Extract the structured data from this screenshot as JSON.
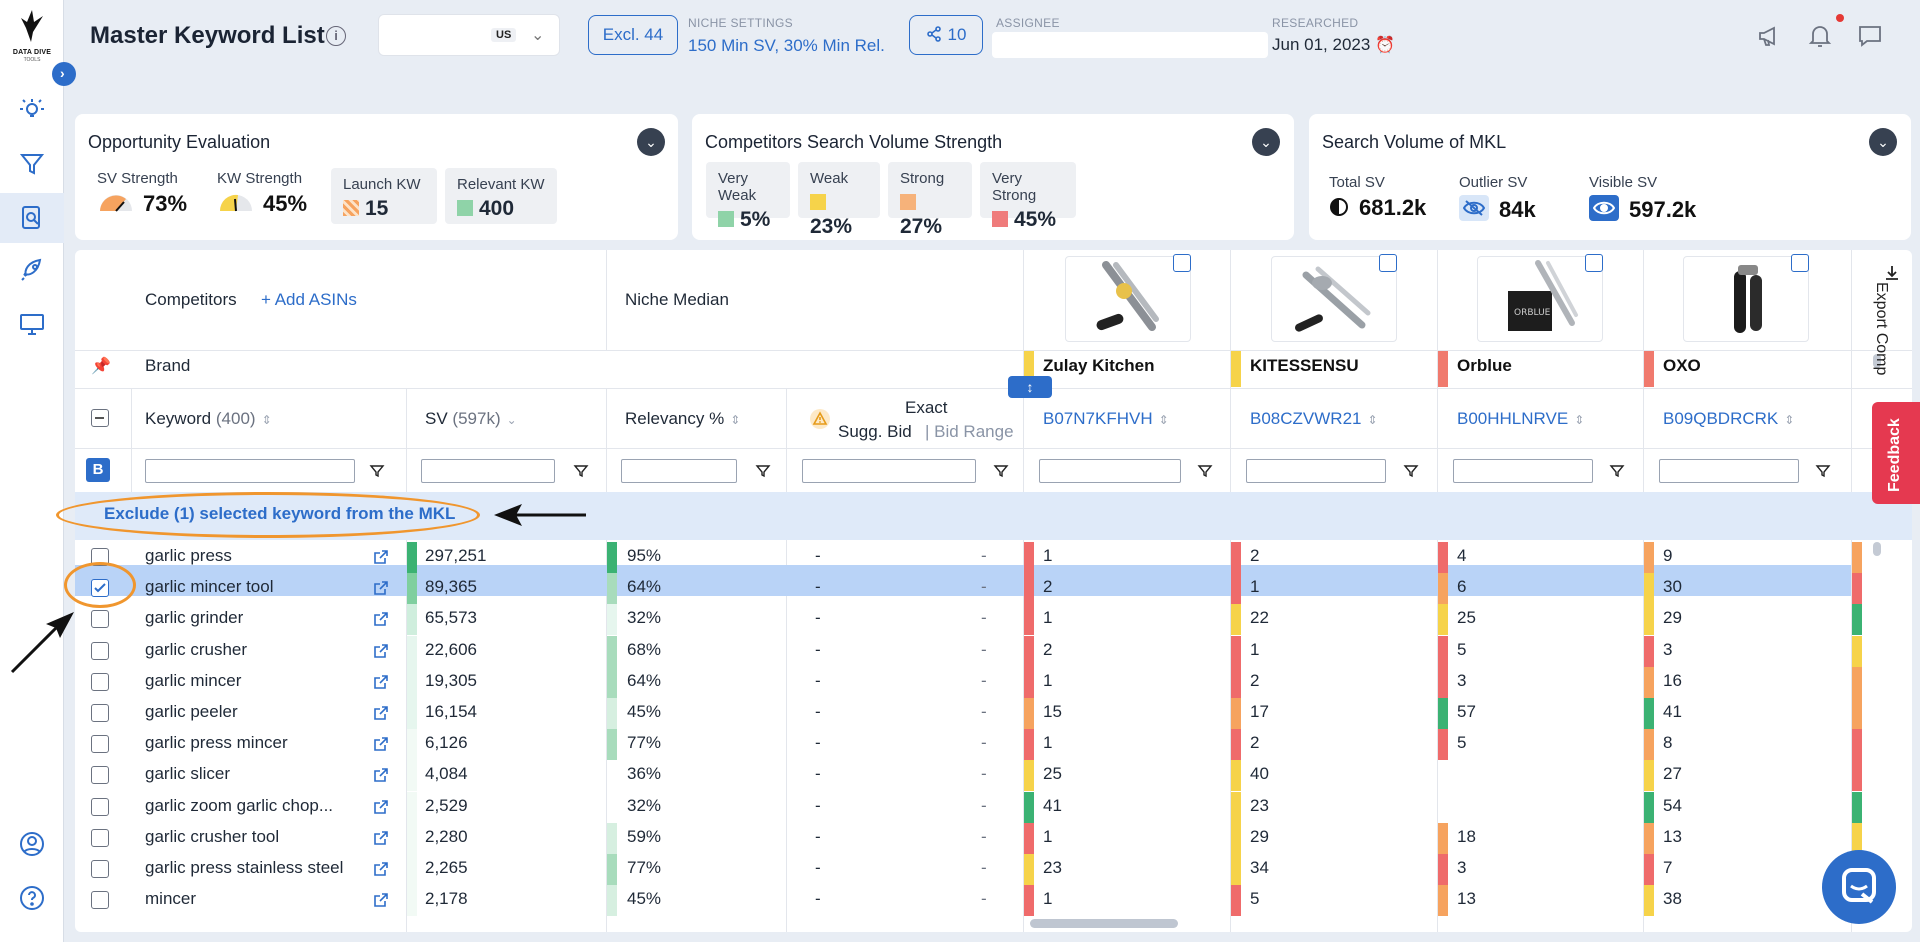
{
  "app": {
    "brand": "DATA DIVE",
    "brand_sub": "TOOLS"
  },
  "header": {
    "title": "Master Keyword List",
    "marketplace": "US",
    "excl_label": "Excl. 44",
    "niche_settings_label": "NICHE SETTINGS",
    "niche_settings_value": "150 Min SV, 30% Min Rel.",
    "share_count": "10",
    "assignee_label": "ASSIGNEE",
    "researched_label": "RESEARCHED",
    "researched_date": "Jun 01, 2023"
  },
  "opportunity": {
    "title": "Opportunity Evaluation",
    "sv_strength_label": "SV Strength",
    "sv_strength": "73%",
    "kw_strength_label": "KW Strength",
    "kw_strength": "45%",
    "launch_kw_label": "Launch KW",
    "launch_kw": "15",
    "relevant_kw_label": "Relevant KW",
    "relevant_kw": "400"
  },
  "competitors_strength": {
    "title": "Competitors Search Volume Strength",
    "very_weak_label": "Very Weak",
    "very_weak": "5%",
    "weak_label": "Weak",
    "weak": "23%",
    "strong_label": "Strong",
    "strong": "27%",
    "very_strong_label": "Very Strong",
    "very_strong": "45%"
  },
  "search_volume": {
    "title": "Search Volume of MKL",
    "total_label": "Total SV",
    "total": "681.2k",
    "outlier_label": "Outlier SV",
    "outlier": "84k",
    "visible_label": "Visible SV",
    "visible": "597.2k"
  },
  "table": {
    "competitors_label": "Competitors",
    "add_asins": "+ Add ASINs",
    "niche_median": "Niche Median",
    "brand_label": "Brand",
    "keyword_col": "Keyword",
    "keyword_count": "(400)",
    "sv_col": "SV",
    "sv_total": "(597k)",
    "relevancy_col": "Relevancy %",
    "exact_label": "Exact",
    "sugg_bid": "Sugg. Bid",
    "bid_range": "Bid Range",
    "filter_badge": "B",
    "exclude_banner": "Exclude (1) selected keyword from the MKL",
    "export_label": "Export Comp",
    "feedback_label": "Feedback",
    "competitors": [
      {
        "brand": "Zulay Kitchen",
        "asin": "B07N7KFHVH",
        "color": "#f6d34a"
      },
      {
        "brand": "KITESSENSU",
        "asin": "B08CZVWR21",
        "color": "#f6d34a"
      },
      {
        "brand": "Orblue",
        "asin": "B00HHLNRVE",
        "color": "#f07a6e"
      },
      {
        "brand": "OXO",
        "asin": "B09QBDRCRK",
        "color": "#f07a6e"
      }
    ],
    "rows": [
      {
        "keyword": "garlic press",
        "sv": "297,251",
        "rel": "95%",
        "bid": "-",
        "range": "-",
        "c": [
          "1",
          "2",
          "4",
          "9"
        ],
        "cc": [
          "#ef6b6b",
          "#ef6b6b",
          "#ef6b6b",
          "#f6a35f"
        ],
        "svbar": "#3bb273",
        "relbar": "#3bb273",
        "next": "#f6a35f",
        "checked": false
      },
      {
        "keyword": "garlic mincer tool",
        "sv": "89,365",
        "rel": "64%",
        "bid": "-",
        "range": "-",
        "c": [
          "2",
          "1",
          "6",
          "30"
        ],
        "cc": [
          "#ef6b6b",
          "#ef6b6b",
          "#f6a35f",
          "#f6d34a"
        ],
        "svbar": "#7fcf9f",
        "relbar": "#a8dcbc",
        "next": "#ef6b6b",
        "checked": true
      },
      {
        "keyword": "garlic grinder",
        "sv": "65,573",
        "rel": "32%",
        "bid": "-",
        "range": "-",
        "c": [
          "1",
          "22",
          "25",
          "29"
        ],
        "cc": [
          "#ef6b6b",
          "#f6d34a",
          "#f6d34a",
          "#f6d34a"
        ],
        "svbar": "#cfeedd",
        "relbar": "#e6f6ee",
        "next": "#3bb273",
        "checked": false
      },
      {
        "keyword": "garlic crusher",
        "sv": "22,606",
        "rel": "68%",
        "bid": "-",
        "range": "-",
        "c": [
          "2",
          "1",
          "5",
          "3"
        ],
        "cc": [
          "#ef6b6b",
          "#ef6b6b",
          "#ef6b6b",
          "#ef6b6b"
        ],
        "svbar": "#e6f6ee",
        "relbar": "#a8dcbc",
        "next": "#f6d34a",
        "checked": false
      },
      {
        "keyword": "garlic mincer",
        "sv": "19,305",
        "rel": "64%",
        "bid": "-",
        "range": "-",
        "c": [
          "1",
          "2",
          "3",
          "16"
        ],
        "cc": [
          "#ef6b6b",
          "#ef6b6b",
          "#ef6b6b",
          "#f6a35f"
        ],
        "svbar": "#e6f6ee",
        "relbar": "#a8dcbc",
        "next": "#f6a35f",
        "checked": false
      },
      {
        "keyword": "garlic peeler",
        "sv": "16,154",
        "rel": "45%",
        "bid": "-",
        "range": "-",
        "c": [
          "15",
          "17",
          "57",
          "41"
        ],
        "cc": [
          "#f6a35f",
          "#f6a35f",
          "#3bb273",
          "#3bb273"
        ],
        "svbar": "#e6f6ee",
        "relbar": "#d6efe0",
        "next": "#f6a35f",
        "checked": false
      },
      {
        "keyword": "garlic press mincer",
        "sv": "6,126",
        "rel": "77%",
        "bid": "-",
        "range": "-",
        "c": [
          "1",
          "2",
          "5",
          "8"
        ],
        "cc": [
          "#ef6b6b",
          "#ef6b6b",
          "#ef6b6b",
          "#f6a35f"
        ],
        "svbar": "#f2faf5",
        "relbar": "#a8dcbc",
        "next": "#ef6b6b",
        "checked": false
      },
      {
        "keyword": "garlic slicer",
        "sv": "4,084",
        "rel": "36%",
        "bid": "-",
        "range": "-",
        "c": [
          "25",
          "40",
          "",
          "27"
        ],
        "cc": [
          "#f6d34a",
          "#f6d34a",
          "#ffffff",
          "#f6d34a"
        ],
        "svbar": "#f2faf5",
        "relbar": "#ffffff",
        "next": "#ef6b6b",
        "checked": false
      },
      {
        "keyword": "garlic zoom garlic chop...",
        "sv": "2,529",
        "rel": "32%",
        "bid": "-",
        "range": "-",
        "c": [
          "41",
          "23",
          "",
          "54"
        ],
        "cc": [
          "#3bb273",
          "#f6d34a",
          "#ffffff",
          "#3bb273"
        ],
        "svbar": "#f2faf5",
        "relbar": "#ffffff",
        "next": "#3bb273",
        "checked": false
      },
      {
        "keyword": "garlic crusher tool",
        "sv": "2,280",
        "rel": "59%",
        "bid": "-",
        "range": "-",
        "c": [
          "1",
          "29",
          "18",
          "13"
        ],
        "cc": [
          "#ef6b6b",
          "#f6d34a",
          "#f6a35f",
          "#f6a35f"
        ],
        "svbar": "#f2faf5",
        "relbar": "#d6efe0",
        "next": "#f6d34a",
        "checked": false
      },
      {
        "keyword": "garlic press stainless steel",
        "sv": "2,265",
        "rel": "77%",
        "bid": "-",
        "range": "-",
        "c": [
          "23",
          "34",
          "3",
          "7"
        ],
        "cc": [
          "#f6d34a",
          "#f6d34a",
          "#ef6b6b",
          "#ef6b6b"
        ],
        "svbar": "#f2faf5",
        "relbar": "#a8dcbc",
        "next": "#f6a35f",
        "checked": false
      },
      {
        "keyword": "mincer",
        "sv": "2,178",
        "rel": "45%",
        "bid": "-",
        "range": "-",
        "c": [
          "1",
          "5",
          "13",
          "38"
        ],
        "cc": [
          "#ef6b6b",
          "#ef6b6b",
          "#f6a35f",
          "#f6d34a"
        ],
        "svbar": "#f2faf5",
        "relbar": "#d6efe0",
        "next": "#f6d34a",
        "checked": false
      }
    ]
  }
}
